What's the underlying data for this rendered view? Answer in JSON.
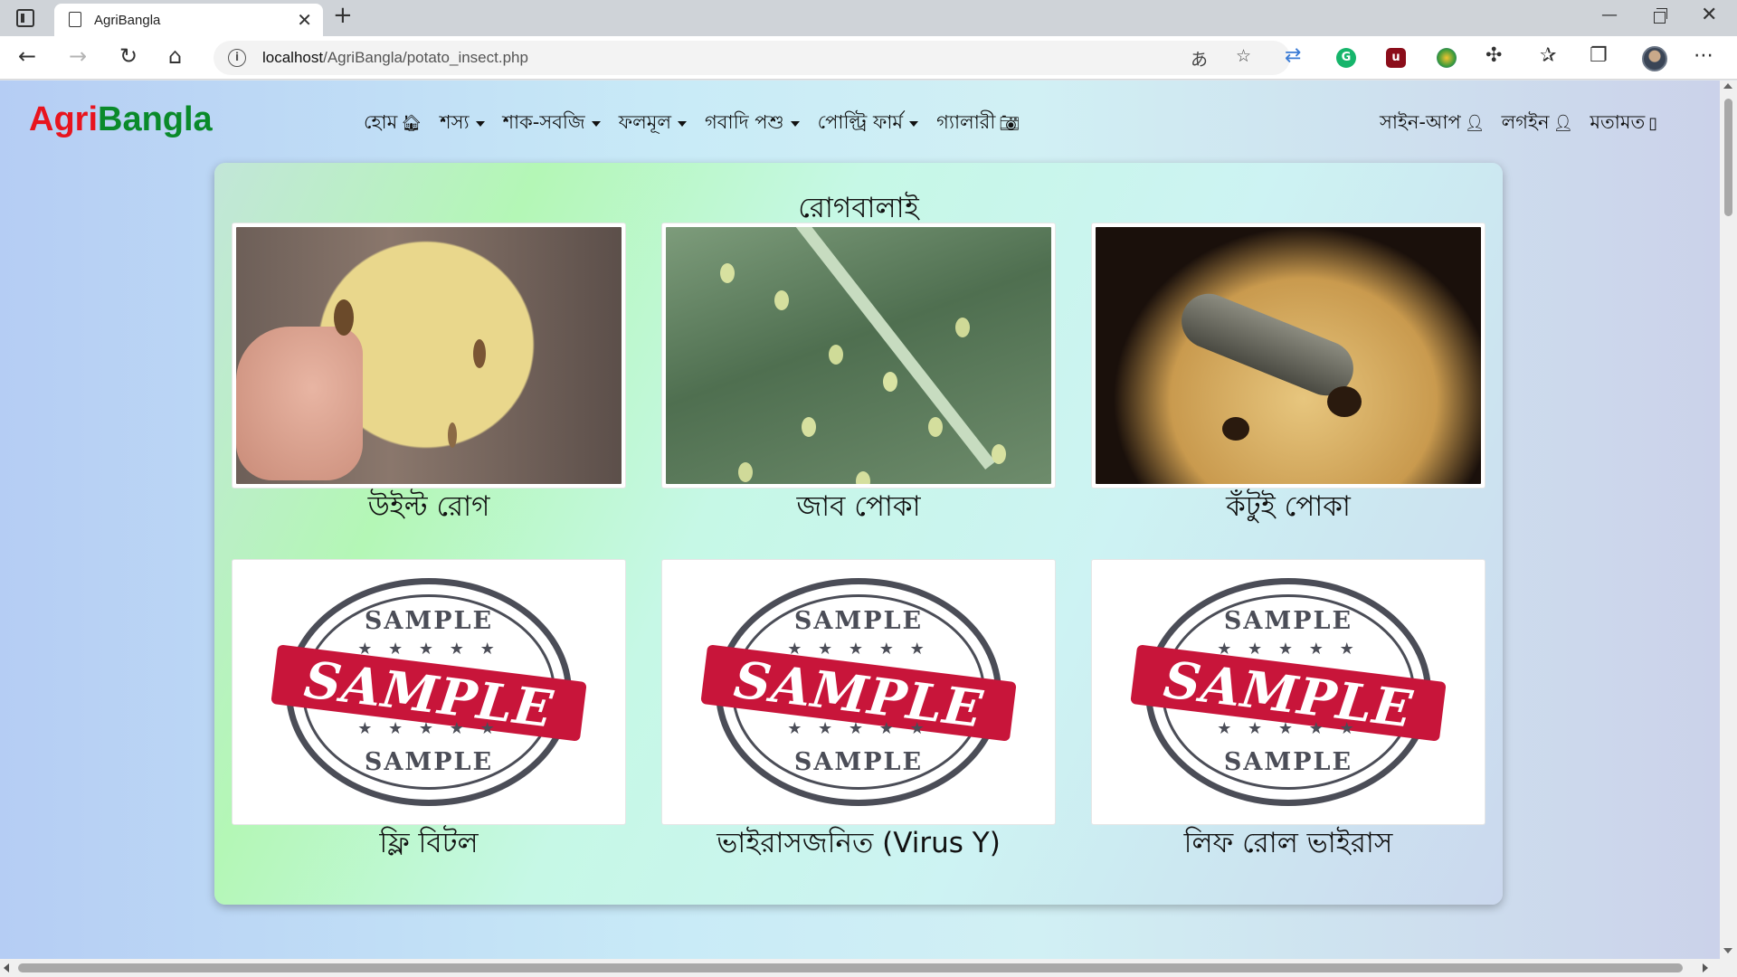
{
  "browser": {
    "tab_title": "AgriBangla",
    "url_host": "localhost",
    "url_path": "/AgriBangla/potato_insect.php"
  },
  "site": {
    "brand_part1": "Agri",
    "brand_part2": "Bangla",
    "colors": {
      "brand_red": "#e8141e",
      "brand_green": "#0a8a2a"
    },
    "menu": {
      "home": "হোম",
      "crops": "শস্য",
      "vegetables": "শাক-সবজি",
      "fruits": "ফলমূল",
      "livestock": "গবাদি পশু",
      "poultry": "পোল্ট্রি ফার্ম",
      "gallery": "গ্যালারী"
    },
    "right_menu": {
      "signup": "সাইন-আপ",
      "login": "লগইন",
      "feedback": "মতামত"
    }
  },
  "card": {
    "title": "রোগবালাই",
    "items": [
      {
        "caption": "উইল্ট রোগ",
        "image": "potato-cut-photo"
      },
      {
        "caption": "জাব পোকা",
        "image": "aphid-leaf-photo"
      },
      {
        "caption": "কঁটুই পোকা",
        "image": "cutworm-potato-photo"
      },
      {
        "caption": "ফ্লি বিটল",
        "image": "sample-stamp"
      },
      {
        "caption": "ভাইরাসজনিত (Virus Y)",
        "image": "sample-stamp"
      },
      {
        "caption": "লিফ রোল ভাইরাস",
        "image": "sample-stamp"
      }
    ],
    "stamp": {
      "top": "SAMPLE",
      "word": "SAMPLE",
      "bottom": "SAMPLE"
    }
  }
}
